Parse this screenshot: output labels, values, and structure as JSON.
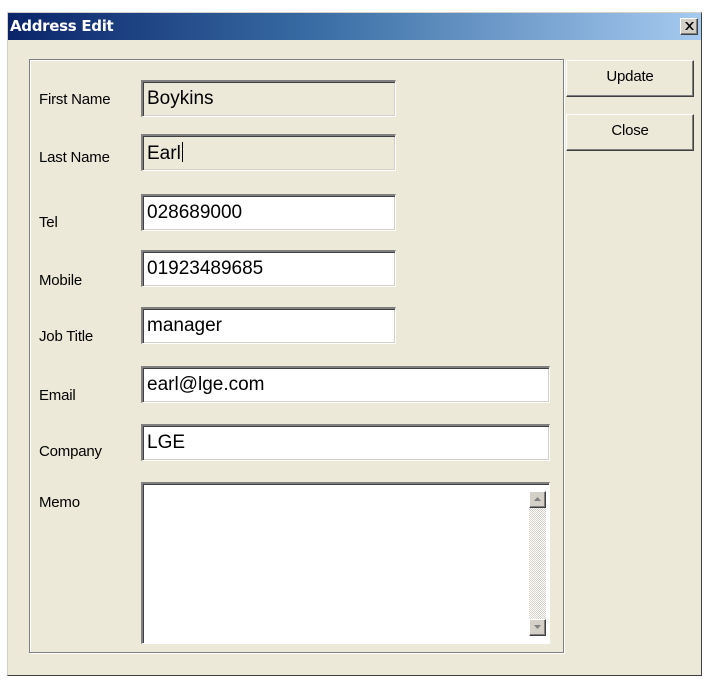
{
  "window": {
    "title": "Address Edit",
    "close_icon": "close-x-icon"
  },
  "form": {
    "first_name": {
      "label": "First Name",
      "value": "Boykins"
    },
    "last_name": {
      "label": "Last Name",
      "value": "Earl"
    },
    "tel": {
      "label": "Tel",
      "value": "028689000"
    },
    "mobile": {
      "label": "Mobile",
      "value": "01923489685"
    },
    "job_title": {
      "label": "Job Title",
      "value": "manager"
    },
    "email": {
      "label": "Email",
      "value": "earl@lge.com"
    },
    "company": {
      "label": "Company",
      "value": "LGE"
    },
    "memo": {
      "label": "Memo",
      "value": ""
    }
  },
  "buttons": {
    "update": "Update",
    "close": "Close"
  },
  "colors": {
    "title_bar_start": "#0a246a",
    "title_bar_end": "#a6caf0",
    "dialog_face": "#ece9d8"
  }
}
